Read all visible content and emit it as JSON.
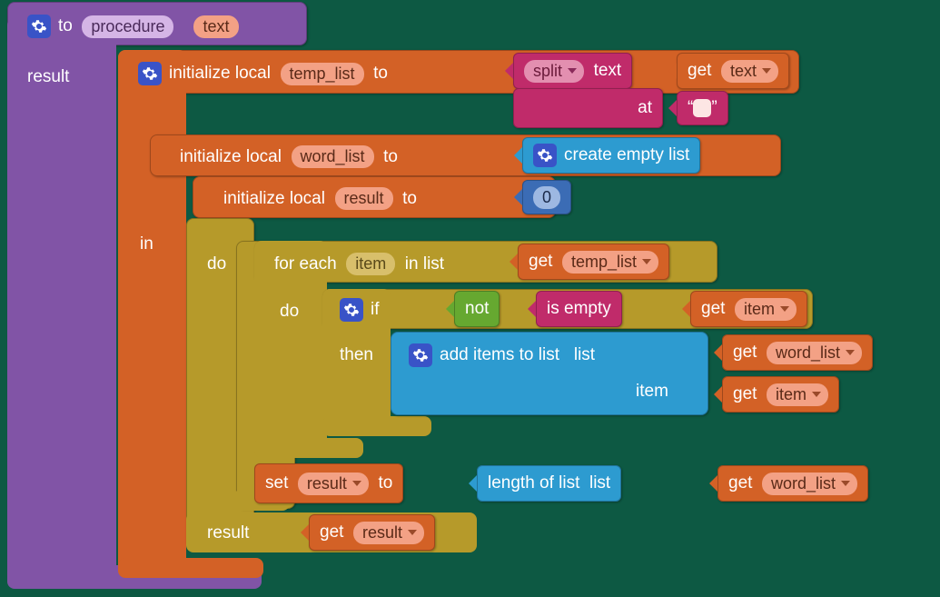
{
  "proc": {
    "to": "to",
    "name": "procedure",
    "param": "text",
    "result_label": "result"
  },
  "init": {
    "kw": "initialize local",
    "to": "to",
    "temp_list": "temp_list",
    "word_list": "word_list",
    "result": "result",
    "in": "in"
  },
  "split": {
    "label": "split",
    "text_kw": "text",
    "at_kw": "at",
    "quote_l": "“",
    "quote_r": "”"
  },
  "get": "get",
  "vars": {
    "text": "text",
    "temp_list": "temp_list",
    "item": "item",
    "word_list": "word_list",
    "result": "result"
  },
  "create_empty": "create empty list",
  "zero": "0",
  "do": "do",
  "foreach": {
    "for_each": "for each",
    "in_list": "in list"
  },
  "if": "if",
  "then": "then",
  "not": "not",
  "is_empty": "is empty",
  "add_items": {
    "label": "add items to list",
    "list": "list",
    "item": "item"
  },
  "set": "set",
  "to_kw": "to",
  "length": {
    "label": "length of list",
    "list": "list"
  },
  "result_kw": "result"
}
